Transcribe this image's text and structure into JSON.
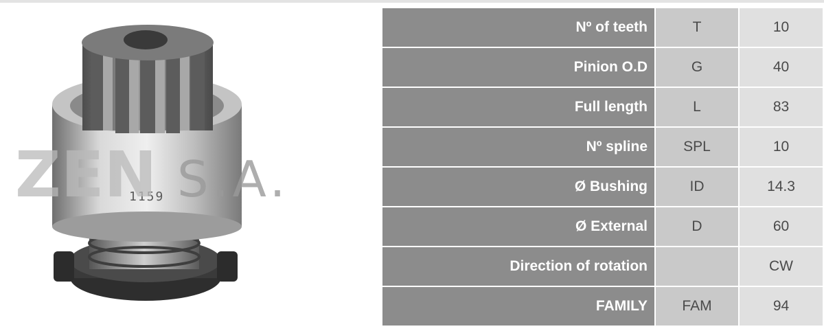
{
  "watermark": {
    "brand": "ZEN",
    "suffix": "S.A."
  },
  "product": {
    "stamp_number": "1159"
  },
  "specs": [
    {
      "label": "Nº of teeth",
      "code": "T",
      "value": "10"
    },
    {
      "label": "Pinion O.D",
      "code": "G",
      "value": "40"
    },
    {
      "label": "Full length",
      "code": "L",
      "value": "83"
    },
    {
      "label": "Nº spline",
      "code": "SPL",
      "value": "10"
    },
    {
      "label": "Ø Bushing",
      "code": "ID",
      "value": "14.3"
    },
    {
      "label": "Ø External",
      "code": "D",
      "value": "60"
    },
    {
      "label": "Direction of rotation",
      "code": "",
      "value": "CW"
    },
    {
      "label": "FAMILY",
      "code": "FAM",
      "value": "94"
    }
  ],
  "colors": {
    "label_bg": "#8c8c8c",
    "code_bg": "#c9c9c9",
    "value_bg": "#e0e0e0"
  }
}
